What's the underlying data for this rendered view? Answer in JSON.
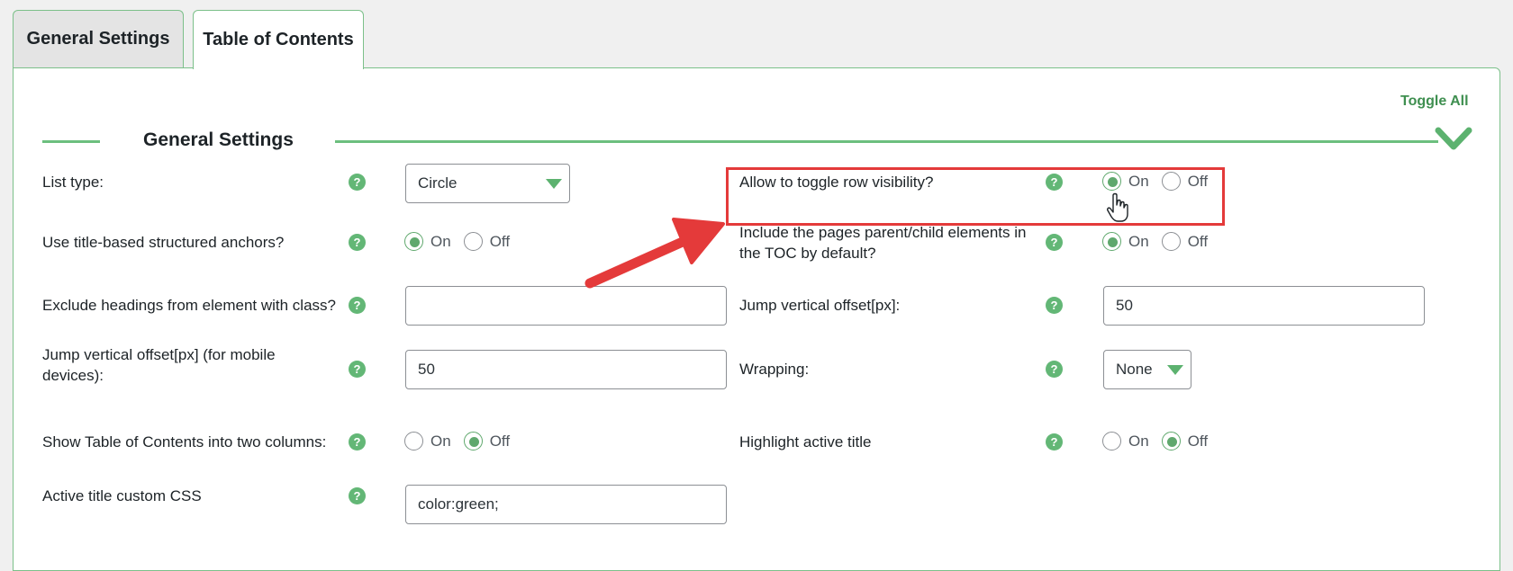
{
  "tabs": [
    {
      "label": "General Settings",
      "active": false
    },
    {
      "label": "Table of Contents",
      "active": true
    }
  ],
  "panel": {
    "toggle_all": "Toggle All",
    "section_title": "General Settings"
  },
  "help_glyph": "?",
  "colors": {
    "accent_green": "#5fa86d",
    "border_green": "#7cc08a",
    "highlight_red": "#e43a3a"
  },
  "fields": {
    "list_type": {
      "label": "List type:",
      "value": "Circle"
    },
    "structured_anchors": {
      "label": "Use title-based structured anchors?",
      "on": "On",
      "off": "Off",
      "selected": "On"
    },
    "exclude_headings": {
      "label": "Exclude headings from element with class?",
      "value": ""
    },
    "mobile_offset": {
      "label_line1": "Jump vertical offset[px] (for mobile",
      "label_line2": "devices):",
      "value": "50"
    },
    "two_columns": {
      "label": "Show Table of Contents into two columns:",
      "on": "On",
      "off": "Off",
      "selected": "Off"
    },
    "active_css": {
      "label": "Active title custom CSS",
      "value": "color:green;"
    },
    "toggle_row": {
      "label": "Allow to toggle row visibility?",
      "on": "On",
      "off": "Off",
      "selected": "On"
    },
    "parent_child": {
      "label_line1": "Include the pages parent/child elements in",
      "label_line2": "the TOC by default?",
      "on": "On",
      "off": "Off",
      "selected": "On"
    },
    "jump_offset": {
      "label": "Jump vertical offset[px]:",
      "value": "50"
    },
    "wrapping": {
      "label": "Wrapping:",
      "value": "None"
    },
    "highlight_active": {
      "label": "Highlight active title",
      "on": "On",
      "off": "Off",
      "selected": "Off"
    }
  },
  "annotation_icons": [
    "red-arrow-icon",
    "hand-cursor-icon"
  ]
}
